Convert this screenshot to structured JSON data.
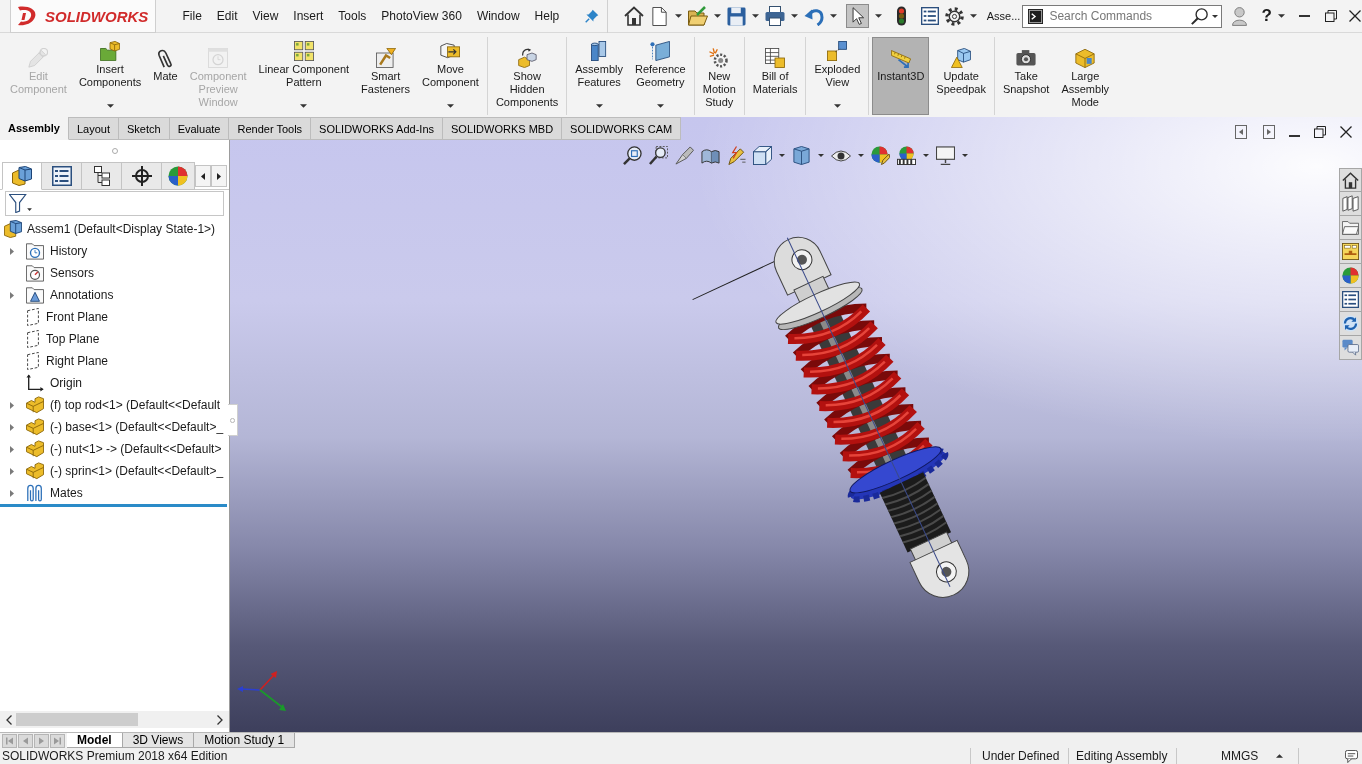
{
  "title_bar": {
    "logo": "SOLIDWORKS",
    "menus": [
      "File",
      "Edit",
      "View",
      "Insert",
      "Tools",
      "PhotoView 360",
      "Window",
      "Help"
    ],
    "select_tool": {
      "active": true
    },
    "document": "Asse...",
    "search": {
      "placeholder": "Search Commands"
    },
    "help": "?"
  },
  "ribbon": {
    "groups": [
      {
        "items": [
          {
            "label": "Edit\nComponent",
            "disabled": true,
            "dropdown": false,
            "pressed": false
          },
          {
            "label": "Insert\nComponents",
            "disabled": false,
            "dropdown": true,
            "pressed": false
          },
          {
            "label": "Mate",
            "disabled": false,
            "dropdown": false,
            "pressed": false
          },
          {
            "label": "Component\nPreview\nWindow",
            "disabled": true,
            "dropdown": false,
            "pressed": false
          },
          {
            "label": "Linear Component\nPattern",
            "disabled": false,
            "dropdown": true,
            "pressed": false
          },
          {
            "label": "Smart\nFasteners",
            "disabled": false,
            "dropdown": false,
            "pressed": false
          },
          {
            "label": "Move\nComponent",
            "disabled": false,
            "dropdown": true,
            "pressed": false
          }
        ]
      },
      {
        "items": [
          {
            "label": "Show\nHidden\nComponents",
            "disabled": false,
            "dropdown": false,
            "pressed": false
          }
        ]
      },
      {
        "items": [
          {
            "label": "Assembly\nFeatures",
            "disabled": false,
            "dropdown": true,
            "pressed": false
          },
          {
            "label": "Reference\nGeometry",
            "disabled": false,
            "dropdown": true,
            "pressed": false
          }
        ]
      },
      {
        "items": [
          {
            "label": "New\nMotion\nStudy",
            "disabled": false,
            "dropdown": false,
            "pressed": false
          }
        ]
      },
      {
        "items": [
          {
            "label": "Bill of\nMaterials",
            "disabled": false,
            "dropdown": false,
            "pressed": false
          }
        ]
      },
      {
        "items": [
          {
            "label": "Exploded\nView",
            "disabled": false,
            "dropdown": true,
            "pressed": false
          }
        ]
      },
      {
        "items": [
          {
            "label": "Instant3D",
            "disabled": false,
            "dropdown": false,
            "pressed": true
          },
          {
            "label": "Update\nSpeedpak",
            "disabled": false,
            "dropdown": false,
            "pressed": false
          }
        ]
      },
      {
        "items": [
          {
            "label": "Take\nSnapshot",
            "disabled": false,
            "dropdown": false,
            "pressed": false
          },
          {
            "label": "Large\nAssembly\nMode",
            "disabled": false,
            "dropdown": false,
            "pressed": false
          }
        ]
      }
    ]
  },
  "command_tabs": [
    {
      "label": "Assembly",
      "selected": true
    },
    {
      "label": "Layout",
      "selected": false
    },
    {
      "label": "Sketch",
      "selected": false
    },
    {
      "label": "Evaluate",
      "selected": false
    },
    {
      "label": "Render Tools",
      "selected": false
    },
    {
      "label": "SOLIDWORKS Add-Ins",
      "selected": false
    },
    {
      "label": "SOLIDWORKS MBD",
      "selected": false
    },
    {
      "label": "SOLIDWORKS CAM",
      "selected": false
    }
  ],
  "feature_manager": {
    "tabs": [
      {
        "selected": true
      },
      {
        "selected": false
      },
      {
        "selected": false
      },
      {
        "selected": false
      },
      {
        "selected": false
      }
    ],
    "tree": {
      "kind": "assembly",
      "label": "Assem1 (Default<Display State-1>)",
      "children": [
        {
          "kind": "history",
          "label": "History",
          "expandable": true
        },
        {
          "kind": "sensors",
          "label": "Sensors",
          "expandable": false
        },
        {
          "kind": "annotations",
          "label": "Annotations",
          "expandable": true
        },
        {
          "kind": "plane",
          "label": "Front Plane",
          "expandable": false
        },
        {
          "kind": "plane",
          "label": "Top Plane",
          "expandable": false
        },
        {
          "kind": "plane",
          "label": "Right Plane",
          "expandable": false
        },
        {
          "kind": "origin",
          "label": "Origin",
          "expandable": false
        },
        {
          "kind": "part",
          "label": "(f) top rod<1> (Default<<Default",
          "expandable": true
        },
        {
          "kind": "part",
          "label": "(-) base<1> (Default<<Default>_",
          "expandable": true
        },
        {
          "kind": "part",
          "label": "(-) nut<1> -> (Default<<Default>",
          "expandable": true
        },
        {
          "kind": "part",
          "label": "(-) sprin<1> (Default<<Default>_",
          "expandable": true
        },
        {
          "kind": "mates",
          "label": "Mates",
          "expandable": true
        }
      ]
    }
  },
  "bottom_tabs": [
    {
      "label": "Model",
      "selected": true
    },
    {
      "label": "3D Views",
      "selected": false
    },
    {
      "label": "Motion Study 1",
      "selected": false
    }
  ],
  "status_bar": {
    "edition": "SOLIDWORKS Premium 2018 x64 Edition",
    "state": "Under Defined",
    "mode": "Editing Assembly",
    "units": "MMGS"
  }
}
